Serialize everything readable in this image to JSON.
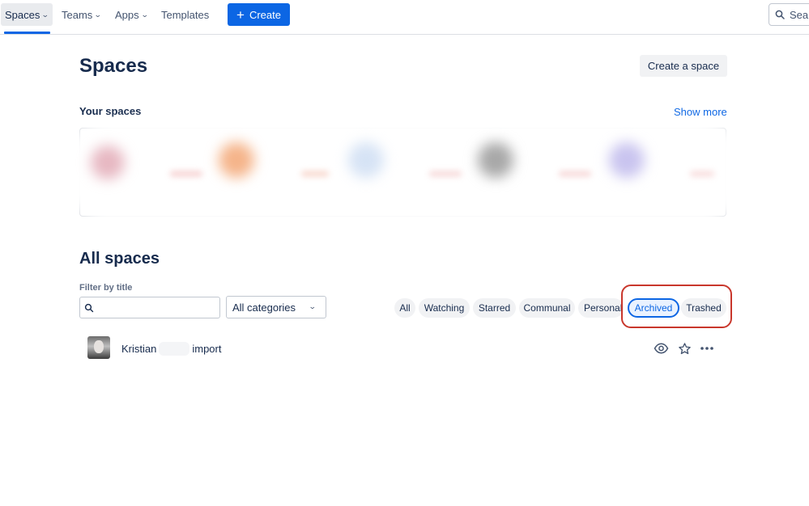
{
  "nav": {
    "items": [
      {
        "label": "Spaces",
        "has_menu": true,
        "active": true
      },
      {
        "label": "Teams",
        "has_menu": true,
        "active": false
      },
      {
        "label": "Apps",
        "has_menu": true,
        "active": false
      },
      {
        "label": "Templates",
        "has_menu": false,
        "active": false
      }
    ],
    "create_label": "Create",
    "search_label": "Sea",
    "accent_color": "#0c66e4"
  },
  "header": {
    "title": "Spaces",
    "create_space_label": "Create a space"
  },
  "your_spaces": {
    "heading": "Your spaces",
    "show_more_label": "Show more"
  },
  "all_spaces": {
    "heading": "All spaces",
    "filter_label": "Filter by title",
    "filter_value": "",
    "category_value": "All categories",
    "chips": [
      {
        "label": "All",
        "selected": false
      },
      {
        "label": "Watching",
        "selected": false
      },
      {
        "label": "Starred",
        "selected": false
      },
      {
        "label": "Communal",
        "selected": false
      },
      {
        "label": "Personal",
        "selected": false
      },
      {
        "label": "Archived",
        "selected": true
      },
      {
        "label": "Trashed",
        "selected": false
      }
    ],
    "highlight_color": "#c9372c",
    "rows": [
      {
        "name_first": "Kristian",
        "name_last": "import",
        "icons": [
          "eye-icon",
          "star-icon",
          "more-icon"
        ]
      }
    ]
  }
}
